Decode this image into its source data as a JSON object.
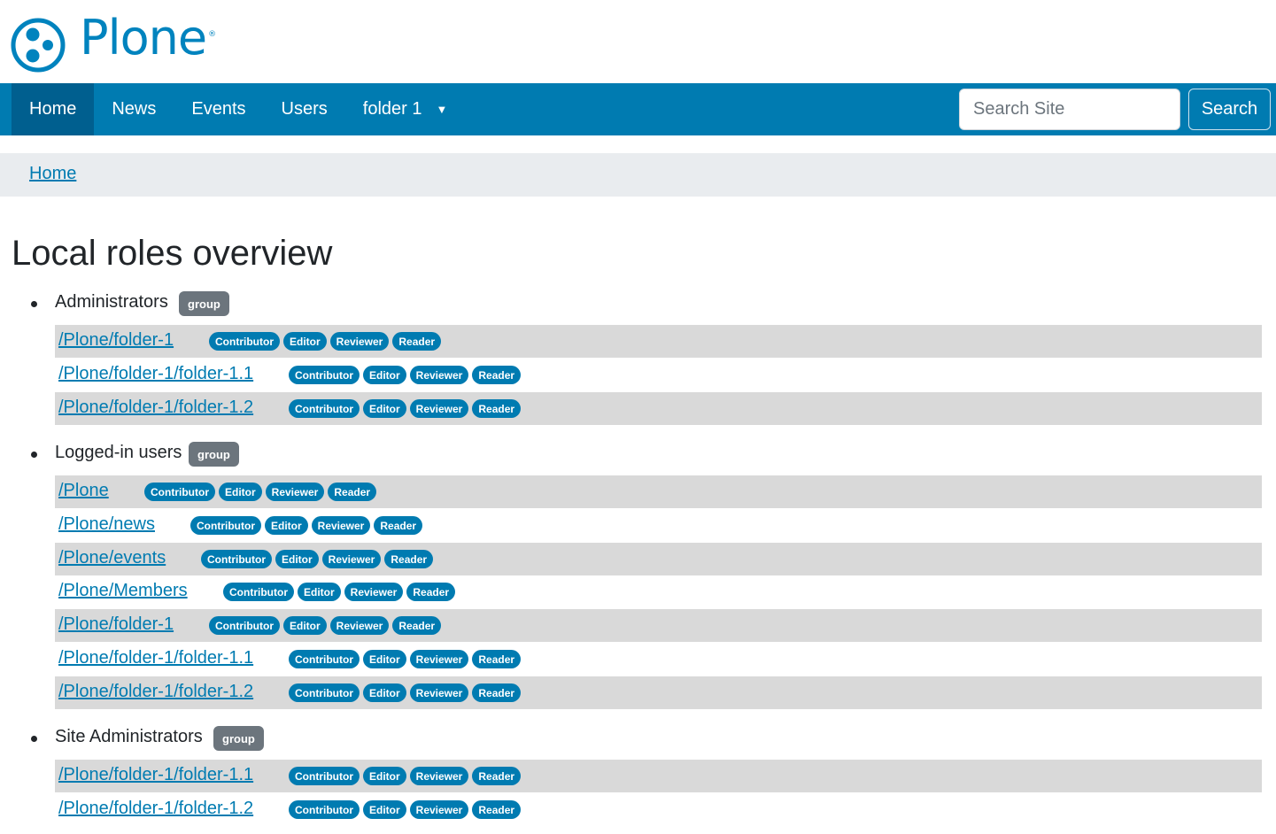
{
  "site": {
    "logo_text": "Plone",
    "logo_mark": "®",
    "colors": {
      "primary": "#007bb1",
      "nav_active": "#005f8f",
      "badge_gray": "#6c757d",
      "row_shade": "#d9d9d9"
    }
  },
  "nav": {
    "items": [
      {
        "label": "Home",
        "active": true
      },
      {
        "label": "News"
      },
      {
        "label": "Events"
      },
      {
        "label": "Users"
      },
      {
        "label": "folder 1",
        "dropdown": true
      }
    ],
    "dropdown_icon": "▼",
    "search_placeholder": "Search Site",
    "search_button": "Search"
  },
  "breadcrumb": {
    "home": "Home"
  },
  "main": {
    "title": "Local roles overview",
    "groups": [
      {
        "name": "Administrators",
        "badge": "group",
        "rows": [
          {
            "path": "/Plone/folder-1",
            "roles": [
              "Contributor",
              "Editor",
              "Reviewer",
              "Reader"
            ]
          },
          {
            "path": "/Plone/folder-1/folder-1.1",
            "roles": [
              "Contributor",
              "Editor",
              "Reviewer",
              "Reader"
            ]
          },
          {
            "path": "/Plone/folder-1/folder-1.2",
            "roles": [
              "Contributor",
              "Editor",
              "Reviewer",
              "Reader"
            ]
          }
        ]
      },
      {
        "name": "Logged-in users",
        "badge": "group",
        "rows": [
          {
            "path": "/Plone",
            "roles": [
              "Contributor",
              "Editor",
              "Reviewer",
              "Reader"
            ]
          },
          {
            "path": "/Plone/news",
            "roles": [
              "Contributor",
              "Editor",
              "Reviewer",
              "Reader"
            ]
          },
          {
            "path": "/Plone/events",
            "roles": [
              "Contributor",
              "Editor",
              "Reviewer",
              "Reader"
            ]
          },
          {
            "path": "/Plone/Members",
            "roles": [
              "Contributor",
              "Editor",
              "Reviewer",
              "Reader"
            ]
          },
          {
            "path": "/Plone/folder-1",
            "roles": [
              "Contributor",
              "Editor",
              "Reviewer",
              "Reader"
            ]
          },
          {
            "path": "/Plone/folder-1/folder-1.1",
            "roles": [
              "Contributor",
              "Editor",
              "Reviewer",
              "Reader"
            ]
          },
          {
            "path": "/Plone/folder-1/folder-1.2",
            "roles": [
              "Contributor",
              "Editor",
              "Reviewer",
              "Reader"
            ]
          }
        ]
      },
      {
        "name": "Site Administrators",
        "badge": "group",
        "rows": [
          {
            "path": "/Plone/folder-1/folder-1.1",
            "roles": [
              "Contributor",
              "Editor",
              "Reviewer",
              "Reader"
            ]
          },
          {
            "path": "/Plone/folder-1/folder-1.2",
            "roles": [
              "Contributor",
              "Editor",
              "Reviewer",
              "Reader"
            ]
          }
        ]
      }
    ]
  }
}
